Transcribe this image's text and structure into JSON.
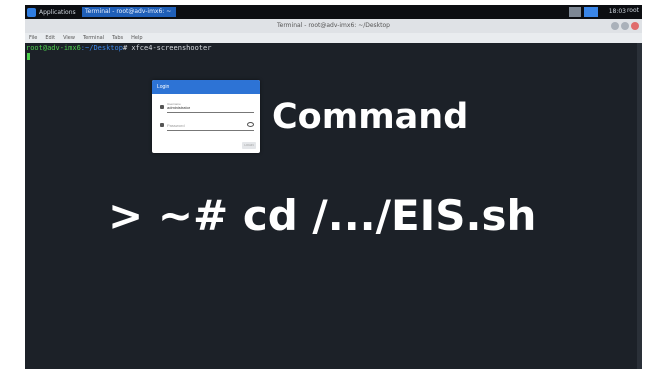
{
  "panel": {
    "apps_label": "Applications",
    "task_label": "Terminal - root@adv-imx6: ~",
    "clock": "18:03",
    "user": "root"
  },
  "window": {
    "title": "Terminal - root@adv-imx6: ~/Desktop"
  },
  "menu": [
    "File",
    "Edit",
    "View",
    "Terminal",
    "Tabs",
    "Help"
  ],
  "terminal": {
    "host": "root@adv-imx6",
    "dir": ":~/Desktop",
    "command": "# xfce4-screenshooter"
  },
  "login_form": {
    "header": "Login",
    "username_label": "Username",
    "username_value": "administrator",
    "password_placeholder": "Password",
    "submit_label": "LOGIN"
  },
  "overlay": {
    "label": "Command",
    "command": "> ~# cd /.../EIS.sh"
  }
}
